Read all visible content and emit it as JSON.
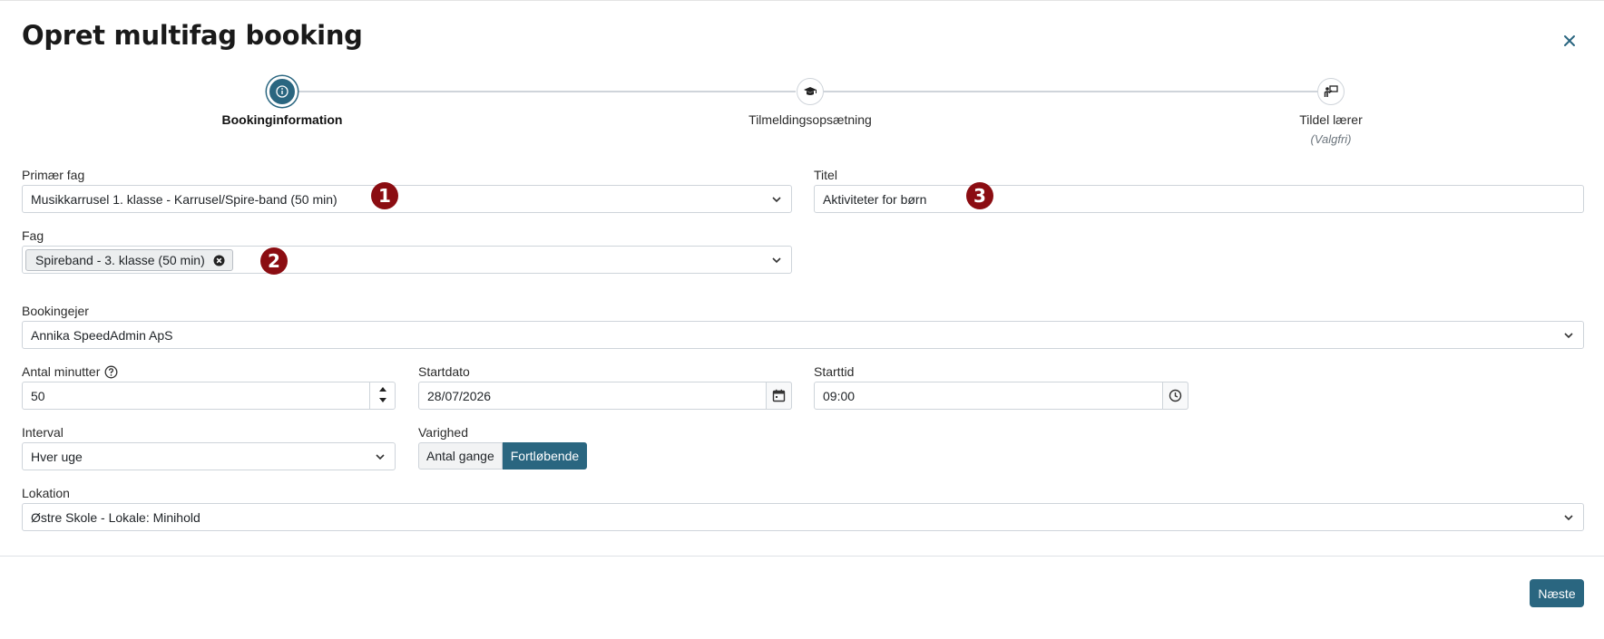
{
  "dialog": {
    "title": "Opret multifag booking"
  },
  "stepper": {
    "steps": [
      {
        "label": "Bookinginformation",
        "sub": ""
      },
      {
        "label": "Tilmeldingsopsætning",
        "sub": ""
      },
      {
        "label": "Tildel lærer",
        "sub": "(Valgfri)"
      }
    ]
  },
  "form": {
    "primary_subject": {
      "label": "Primær fag",
      "value": "Musikkarrusel 1. klasse - Karrusel/Spire-band (50 min)"
    },
    "title": {
      "label": "Titel",
      "value": "Aktiviteter for børn"
    },
    "subjects": {
      "label": "Fag",
      "tags": [
        "Spireband - 3. klasse (50 min)"
      ]
    },
    "owner": {
      "label": "Bookingejer",
      "value": "Annika SpeedAdmin ApS"
    },
    "minutes": {
      "label": "Antal minutter",
      "value": "50"
    },
    "start_date": {
      "label": "Startdato",
      "value": "28/07/2026"
    },
    "start_time": {
      "label": "Starttid",
      "value": "09:00"
    },
    "interval": {
      "label": "Interval",
      "value": "Hver uge"
    },
    "duration": {
      "label": "Varighed",
      "options": [
        "Antal gange",
        "Fortløbende"
      ],
      "selected": "Fortløbende"
    },
    "location": {
      "label": "Lokation",
      "value": "Østre Skole - Lokale: Minihold"
    }
  },
  "annotations": {
    "one": "1",
    "two": "2",
    "three": "3"
  },
  "footer": {
    "next_label": "Næste"
  },
  "colors": {
    "primary": "#2a6680",
    "badge": "#8b0d12"
  },
  "icons": {
    "close": "close-icon",
    "step1": "info-icon",
    "step2": "graduation-cap-icon",
    "step3": "teacher-board-icon",
    "help": "help-circle-icon",
    "calendar": "calendar-icon",
    "clock": "clock-icon",
    "dropdown": "chevron-down-icon",
    "tag_remove": "remove-circle-icon"
  }
}
